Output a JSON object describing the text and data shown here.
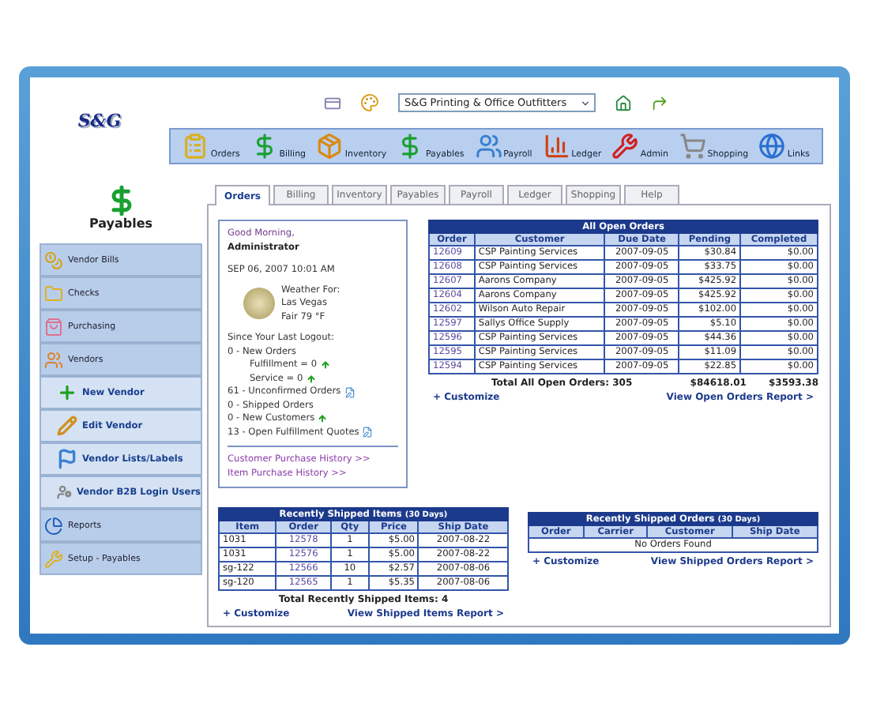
{
  "header": {
    "logo": "S&G",
    "company_select": "S&G Printing & Office Outfitters"
  },
  "toolbar": [
    {
      "label": "Orders"
    },
    {
      "label": "Billing"
    },
    {
      "label": "Inventory"
    },
    {
      "label": "Payables"
    },
    {
      "label": "Payroll"
    },
    {
      "label": "Ledger"
    },
    {
      "label": "Admin"
    },
    {
      "label": "Shopping"
    },
    {
      "label": "Links"
    }
  ],
  "sidebar": {
    "title": "Payables",
    "items": [
      {
        "label": "Vendor Bills",
        "kind": "main"
      },
      {
        "label": "Checks",
        "kind": "main"
      },
      {
        "label": "Purchasing",
        "kind": "main"
      },
      {
        "label": "Vendors",
        "kind": "main"
      },
      {
        "label": "New Vendor",
        "kind": "sub"
      },
      {
        "label": "Edit Vendor",
        "kind": "sub"
      },
      {
        "label": "Vendor Lists/Labels",
        "kind": "sub"
      },
      {
        "label": "Vendor B2B Login Users",
        "kind": "sub"
      },
      {
        "label": "Reports",
        "kind": "main"
      },
      {
        "label": "Setup - Payables",
        "kind": "main"
      }
    ]
  },
  "tabs": [
    {
      "label": "Orders",
      "selected": true
    },
    {
      "label": "Billing",
      "selected": false
    },
    {
      "label": "Inventory",
      "selected": false
    },
    {
      "label": "Payables",
      "selected": false
    },
    {
      "label": "Payroll",
      "selected": false
    },
    {
      "label": "Ledger",
      "selected": false
    },
    {
      "label": "Shopping",
      "selected": false
    },
    {
      "label": "Help",
      "selected": false
    }
  ],
  "greeting": {
    "salutation": "Good Morning,",
    "user": "Administrator",
    "datetime": "SEP 06, 2007 10:01 AM",
    "weather": [
      "Weather For:",
      "Las Vegas",
      "Fair 79 °F"
    ],
    "since_label": "Since Your Last Logout:",
    "stats": [
      {
        "text": "0 - New Orders",
        "kind": "plain"
      },
      {
        "text": "Fulfillment = 0",
        "kind": "indent_up"
      },
      {
        "text": "Service = 0",
        "kind": "indent_up"
      },
      {
        "text": "61 - Unconfirmed Orders",
        "kind": "note"
      },
      {
        "text": "0 - Shipped Orders",
        "kind": "plain"
      },
      {
        "text": "0 - New Customers",
        "kind": "up"
      },
      {
        "text": "13 - Open Fulfillment Quotes",
        "kind": "note"
      }
    ],
    "links": [
      "Customer Purchase History >>",
      "Item Purchase History >>"
    ]
  },
  "open_orders": {
    "title": "All Open Orders",
    "columns": [
      "Order",
      "Customer",
      "Due Date",
      "Pending",
      "Completed"
    ],
    "rows": [
      [
        "12609",
        "CSP Painting Services",
        "2007-09-05",
        "$30.84",
        "$0.00"
      ],
      [
        "12608",
        "CSP Painting Services",
        "2007-09-05",
        "$33.75",
        "$0.00"
      ],
      [
        "12607",
        "Aarons Company",
        "2007-09-05",
        "$425.92",
        "$0.00"
      ],
      [
        "12604",
        "Aarons Company",
        "2007-09-05",
        "$425.92",
        "$0.00"
      ],
      [
        "12602",
        "Wilson Auto Repair",
        "2007-09-05",
        "$102.00",
        "$0.00"
      ],
      [
        "12597",
        "Sallys Office Supply",
        "2007-09-05",
        "$5.10",
        "$0.00"
      ],
      [
        "12596",
        "CSP Painting Services",
        "2007-09-05",
        "$44.36",
        "$0.00"
      ],
      [
        "12595",
        "CSP Painting Services",
        "2007-09-05",
        "$11.09",
        "$0.00"
      ],
      [
        "12594",
        "CSP Painting Services",
        "2007-09-05",
        "$22.85",
        "$0.00"
      ]
    ],
    "total_label": "Total All Open Orders: 305",
    "total_pending": "$84618.01",
    "total_completed": "$3593.38",
    "customize": "+ Customize",
    "report_link": "View Open Orders Report >"
  },
  "shipped_items": {
    "title": "Recently Shipped Items",
    "title_note": "(30 Days)",
    "columns": [
      "Item",
      "Order",
      "Qty",
      "Price",
      "Ship Date"
    ],
    "rows": [
      [
        "1031",
        "12578",
        "1",
        "$5.00",
        "2007-08-22"
      ],
      [
        "1031",
        "12576",
        "1",
        "$5.00",
        "2007-08-22"
      ],
      [
        "sg-122",
        "12566",
        "10",
        "$2.57",
        "2007-08-06"
      ],
      [
        "sg-120",
        "12565",
        "1",
        "$5.35",
        "2007-08-06"
      ]
    ],
    "total_label": "Total Recently Shipped Items: 4",
    "customize": "+ Customize",
    "report_link": "View Shipped Items Report >"
  },
  "shipped_orders": {
    "title": "Recently Shipped Orders",
    "title_note": "(30 Days)",
    "columns": [
      "Order",
      "Carrier",
      "Customer",
      "Ship Date"
    ],
    "empty": "No Orders Found",
    "customize": "+ Customize",
    "report_link": "View Shipped Orders Report >"
  }
}
